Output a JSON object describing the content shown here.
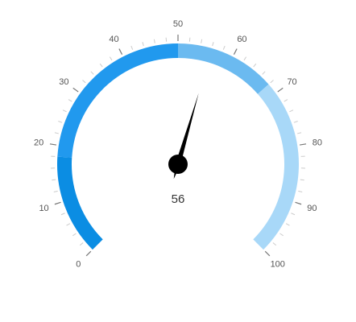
{
  "chart_data": {
    "type": "gauge",
    "min": 0,
    "max": 100,
    "value": 56,
    "value_text": "56",
    "major_ticks": [
      0,
      10,
      20,
      30,
      40,
      50,
      60,
      70,
      80,
      90,
      100
    ],
    "tick_labels": [
      "0",
      "10",
      "20",
      "30",
      "40",
      "50",
      "60",
      "70",
      "80",
      "90",
      "100"
    ],
    "minor_tick_step": 2,
    "bands": [
      {
        "from": 0,
        "to": 18,
        "color": "#0b8de3"
      },
      {
        "from": 18,
        "to": 50,
        "color": "#2199ee"
      },
      {
        "from": 50,
        "to": 68,
        "color": "#6bbaf0"
      },
      {
        "from": 68,
        "to": 100,
        "color": "#a8d8f8"
      }
    ],
    "needle_color": "#000000",
    "tick_color_major": "#777777",
    "tick_color_minor": "#cccccc"
  }
}
